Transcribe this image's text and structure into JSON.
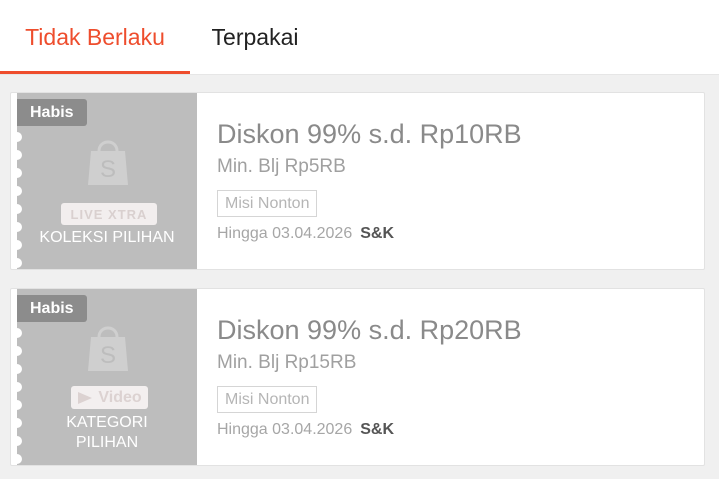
{
  "tabs": [
    {
      "label": "Tidak Berlaku",
      "active": true
    },
    {
      "label": "Terpakai",
      "active": false
    }
  ],
  "colors": {
    "accent": "#ee4d2d",
    "voucher_left": "#bdbdbd",
    "badge": "#8c8c8c"
  },
  "vouchers": [
    {
      "badge": "Habis",
      "logo": "LIVE XTRA",
      "category": "KOLEKSI PILIHAN",
      "title": "Diskon 99% s.d. Rp10RB",
      "min_spend": "Min. Blj Rp5RB",
      "mission": "Misi Nonton",
      "expiry": "Hingga 03.04.2026",
      "terms": "S&K",
      "icon": "shopee-bag-icon"
    },
    {
      "badge": "Habis",
      "logo": "Video",
      "category": "KATEGORI PILIHAN",
      "title": "Diskon 99% s.d. Rp20RB",
      "min_spend": "Min. Blj Rp15RB",
      "mission": "Misi Nonton",
      "expiry": "Hingga 03.04.2026",
      "terms": "S&K",
      "icon": "shopee-bag-icon"
    }
  ]
}
